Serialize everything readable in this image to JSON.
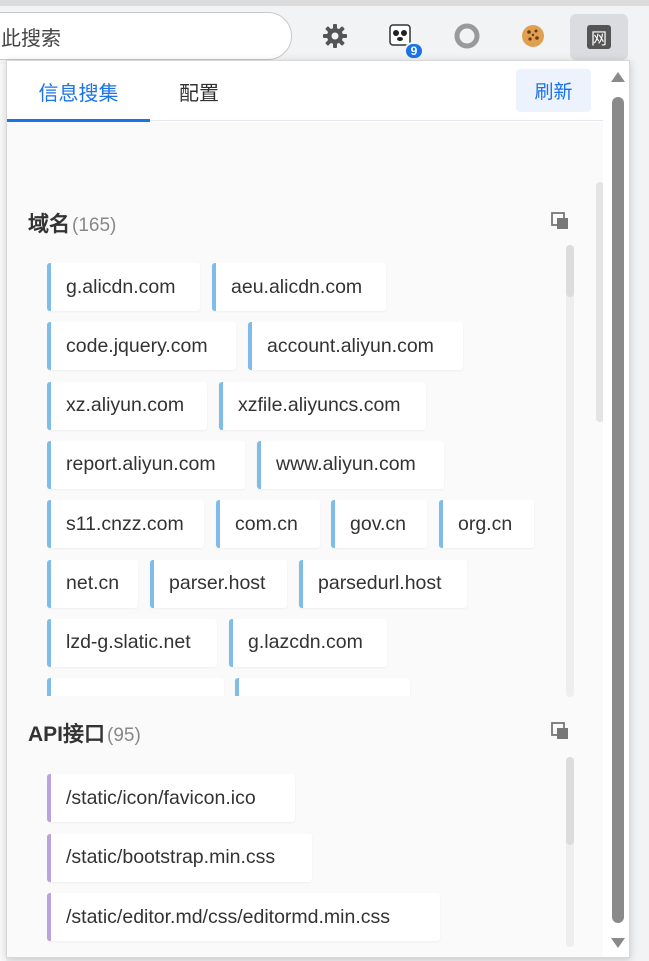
{
  "browser": {
    "search_text": "此搜索",
    "extension_badge": "9",
    "active_extension_label": "网"
  },
  "popup": {
    "tabs": [
      {
        "label": "信息搜集",
        "active": true
      },
      {
        "label": "配置",
        "active": false
      }
    ],
    "refresh_label": "刷新",
    "domains": {
      "title": "域名",
      "count": "(165)",
      "items": [
        "g.alicdn.com",
        "aeu.alicdn.com",
        "code.jquery.com",
        "account.aliyun.com",
        "xz.aliyun.com",
        "xzfile.aliyuncs.com",
        "report.aliyun.com",
        "www.aliyun.com",
        "s11.cnzz.com",
        "com.cn",
        "gov.cn",
        "org.cn",
        "net.cn",
        "parser.host",
        "parsedurl.host",
        "lzd-g.slatic.net",
        "g.lazcdn.com"
      ]
    },
    "apis": {
      "title": "API接口",
      "count": "(95)",
      "items": [
        "/static/icon/favicon.ico",
        "/static/bootstrap.min.css",
        "/static/editor.md/css/editormd.min.css"
      ]
    }
  },
  "colors": {
    "accent": "#1a73e8",
    "domain_border": "#7fbde8",
    "api_border": "#b9a3de"
  }
}
